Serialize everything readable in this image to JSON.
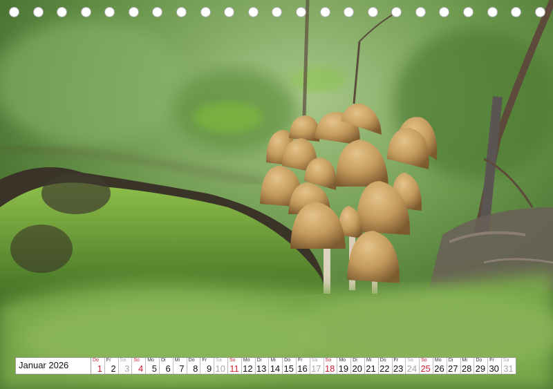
{
  "calendar": {
    "month_label": "Januar 2026",
    "accent_red": "#d0202f",
    "weekend_grey": "#a6a6a6",
    "days": [
      {
        "wd": "Do",
        "n": "1",
        "t": "hol"
      },
      {
        "wd": "Fr",
        "n": "2",
        "t": ""
      },
      {
        "wd": "Sa",
        "n": "3",
        "t": "sat"
      },
      {
        "wd": "So",
        "n": "4",
        "t": "sun"
      },
      {
        "wd": "Mo",
        "n": "5",
        "t": ""
      },
      {
        "wd": "Di",
        "n": "6",
        "t": ""
      },
      {
        "wd": "Mi",
        "n": "7",
        "t": ""
      },
      {
        "wd": "Do",
        "n": "8",
        "t": ""
      },
      {
        "wd": "Fr",
        "n": "9",
        "t": ""
      },
      {
        "wd": "Sa",
        "n": "10",
        "t": "sat"
      },
      {
        "wd": "So",
        "n": "11",
        "t": "sun"
      },
      {
        "wd": "Mo",
        "n": "12",
        "t": ""
      },
      {
        "wd": "Di",
        "n": "13",
        "t": ""
      },
      {
        "wd": "Mi",
        "n": "14",
        "t": ""
      },
      {
        "wd": "Do",
        "n": "15",
        "t": ""
      },
      {
        "wd": "Fr",
        "n": "16",
        "t": ""
      },
      {
        "wd": "Sa",
        "n": "17",
        "t": "sat"
      },
      {
        "wd": "So",
        "n": "18",
        "t": "sun"
      },
      {
        "wd": "Mo",
        "n": "19",
        "t": ""
      },
      {
        "wd": "Di",
        "n": "20",
        "t": ""
      },
      {
        "wd": "Mi",
        "n": "21",
        "t": ""
      },
      {
        "wd": "Do",
        "n": "22",
        "t": ""
      },
      {
        "wd": "Fr",
        "n": "23",
        "t": ""
      },
      {
        "wd": "Sa",
        "n": "24",
        "t": "sat"
      },
      {
        "wd": "So",
        "n": "25",
        "t": "sun"
      },
      {
        "wd": "Mo",
        "n": "26",
        "t": ""
      },
      {
        "wd": "Di",
        "n": "27",
        "t": ""
      },
      {
        "wd": "Mi",
        "n": "28",
        "t": ""
      },
      {
        "wd": "Do",
        "n": "29",
        "t": ""
      },
      {
        "wd": "Fr",
        "n": "30",
        "t": ""
      },
      {
        "wd": "Sa",
        "n": "31",
        "t": "sat"
      }
    ]
  }
}
